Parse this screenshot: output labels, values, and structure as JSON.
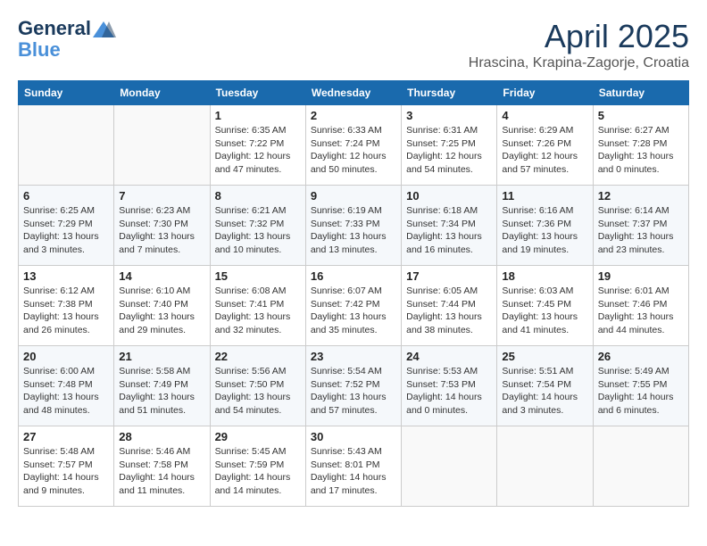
{
  "header": {
    "logo_line1": "General",
    "logo_line2": "Blue",
    "month": "April 2025",
    "location": "Hrascina, Krapina-Zagorje, Croatia"
  },
  "weekdays": [
    "Sunday",
    "Monday",
    "Tuesday",
    "Wednesday",
    "Thursday",
    "Friday",
    "Saturday"
  ],
  "weeks": [
    [
      {
        "day": "",
        "info": ""
      },
      {
        "day": "",
        "info": ""
      },
      {
        "day": "1",
        "info": "Sunrise: 6:35 AM\nSunset: 7:22 PM\nDaylight: 12 hours and 47 minutes."
      },
      {
        "day": "2",
        "info": "Sunrise: 6:33 AM\nSunset: 7:24 PM\nDaylight: 12 hours and 50 minutes."
      },
      {
        "day": "3",
        "info": "Sunrise: 6:31 AM\nSunset: 7:25 PM\nDaylight: 12 hours and 54 minutes."
      },
      {
        "day": "4",
        "info": "Sunrise: 6:29 AM\nSunset: 7:26 PM\nDaylight: 12 hours and 57 minutes."
      },
      {
        "day": "5",
        "info": "Sunrise: 6:27 AM\nSunset: 7:28 PM\nDaylight: 13 hours and 0 minutes."
      }
    ],
    [
      {
        "day": "6",
        "info": "Sunrise: 6:25 AM\nSunset: 7:29 PM\nDaylight: 13 hours and 3 minutes."
      },
      {
        "day": "7",
        "info": "Sunrise: 6:23 AM\nSunset: 7:30 PM\nDaylight: 13 hours and 7 minutes."
      },
      {
        "day": "8",
        "info": "Sunrise: 6:21 AM\nSunset: 7:32 PM\nDaylight: 13 hours and 10 minutes."
      },
      {
        "day": "9",
        "info": "Sunrise: 6:19 AM\nSunset: 7:33 PM\nDaylight: 13 hours and 13 minutes."
      },
      {
        "day": "10",
        "info": "Sunrise: 6:18 AM\nSunset: 7:34 PM\nDaylight: 13 hours and 16 minutes."
      },
      {
        "day": "11",
        "info": "Sunrise: 6:16 AM\nSunset: 7:36 PM\nDaylight: 13 hours and 19 minutes."
      },
      {
        "day": "12",
        "info": "Sunrise: 6:14 AM\nSunset: 7:37 PM\nDaylight: 13 hours and 23 minutes."
      }
    ],
    [
      {
        "day": "13",
        "info": "Sunrise: 6:12 AM\nSunset: 7:38 PM\nDaylight: 13 hours and 26 minutes."
      },
      {
        "day": "14",
        "info": "Sunrise: 6:10 AM\nSunset: 7:40 PM\nDaylight: 13 hours and 29 minutes."
      },
      {
        "day": "15",
        "info": "Sunrise: 6:08 AM\nSunset: 7:41 PM\nDaylight: 13 hours and 32 minutes."
      },
      {
        "day": "16",
        "info": "Sunrise: 6:07 AM\nSunset: 7:42 PM\nDaylight: 13 hours and 35 minutes."
      },
      {
        "day": "17",
        "info": "Sunrise: 6:05 AM\nSunset: 7:44 PM\nDaylight: 13 hours and 38 minutes."
      },
      {
        "day": "18",
        "info": "Sunrise: 6:03 AM\nSunset: 7:45 PM\nDaylight: 13 hours and 41 minutes."
      },
      {
        "day": "19",
        "info": "Sunrise: 6:01 AM\nSunset: 7:46 PM\nDaylight: 13 hours and 44 minutes."
      }
    ],
    [
      {
        "day": "20",
        "info": "Sunrise: 6:00 AM\nSunset: 7:48 PM\nDaylight: 13 hours and 48 minutes."
      },
      {
        "day": "21",
        "info": "Sunrise: 5:58 AM\nSunset: 7:49 PM\nDaylight: 13 hours and 51 minutes."
      },
      {
        "day": "22",
        "info": "Sunrise: 5:56 AM\nSunset: 7:50 PM\nDaylight: 13 hours and 54 minutes."
      },
      {
        "day": "23",
        "info": "Sunrise: 5:54 AM\nSunset: 7:52 PM\nDaylight: 13 hours and 57 minutes."
      },
      {
        "day": "24",
        "info": "Sunrise: 5:53 AM\nSunset: 7:53 PM\nDaylight: 14 hours and 0 minutes."
      },
      {
        "day": "25",
        "info": "Sunrise: 5:51 AM\nSunset: 7:54 PM\nDaylight: 14 hours and 3 minutes."
      },
      {
        "day": "26",
        "info": "Sunrise: 5:49 AM\nSunset: 7:55 PM\nDaylight: 14 hours and 6 minutes."
      }
    ],
    [
      {
        "day": "27",
        "info": "Sunrise: 5:48 AM\nSunset: 7:57 PM\nDaylight: 14 hours and 9 minutes."
      },
      {
        "day": "28",
        "info": "Sunrise: 5:46 AM\nSunset: 7:58 PM\nDaylight: 14 hours and 11 minutes."
      },
      {
        "day": "29",
        "info": "Sunrise: 5:45 AM\nSunset: 7:59 PM\nDaylight: 14 hours and 14 minutes."
      },
      {
        "day": "30",
        "info": "Sunrise: 5:43 AM\nSunset: 8:01 PM\nDaylight: 14 hours and 17 minutes."
      },
      {
        "day": "",
        "info": ""
      },
      {
        "day": "",
        "info": ""
      },
      {
        "day": "",
        "info": ""
      }
    ]
  ]
}
